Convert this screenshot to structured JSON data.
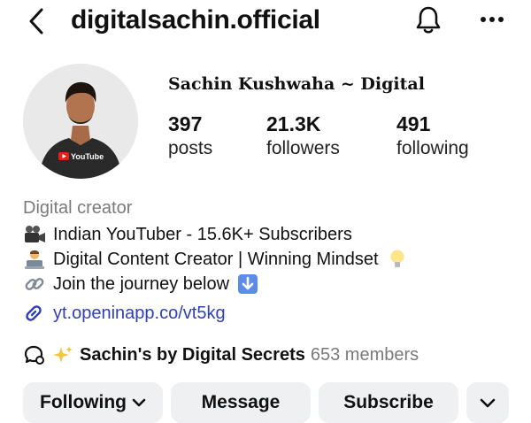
{
  "header": {
    "username": "digitalsachin.official"
  },
  "profile": {
    "display_name": "Sachin Kushwaha ~ Digital",
    "avatar_shirt_text": "YouTube",
    "stats": [
      {
        "value": "397",
        "label": "posts"
      },
      {
        "value": "21.3K",
        "label": "followers"
      },
      {
        "value": "491",
        "label": "following"
      }
    ]
  },
  "bio": {
    "category": "Digital creator",
    "lines": [
      {
        "icon": "video-camera-icon",
        "text": "Indian YouTuber - 15.6K+ Subscribers"
      },
      {
        "icon": "technologist-icon",
        "text": "Digital Content Creator | Winning Mindset"
      },
      {
        "icon": "link-chain-icon",
        "text": "Join the journey below"
      }
    ],
    "link": "yt.openinapp.co/vt5kg"
  },
  "channel": {
    "name": "Sachin's by Digital Secrets",
    "members": "653 members"
  },
  "actions": {
    "following_label": "Following",
    "message_label": "Message",
    "subscribe_label": "Subscribe"
  },
  "colors": {
    "link": "#2f3fb8",
    "button_bg": "#eff0f2",
    "muted_text": "#7a7a7a"
  }
}
